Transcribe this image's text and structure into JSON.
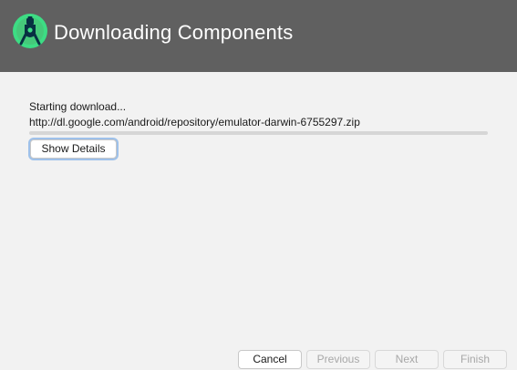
{
  "header": {
    "title": "Downloading Components",
    "icon": "android-studio-logo-icon",
    "background": "#606060"
  },
  "status": {
    "message": "Starting download...",
    "url": "http://dl.google.com/android/repository/emulator-darwin-6755297.zip",
    "progress_percent": 0
  },
  "details_button": {
    "label": "Show Details"
  },
  "footer": {
    "cancel_label": "Cancel",
    "previous_label": "Previous",
    "next_label": "Next",
    "finish_label": "Finish"
  },
  "colors": {
    "accent": "#4a90d9",
    "logo_green": "#3ddc84",
    "logo_dark": "#073042"
  }
}
